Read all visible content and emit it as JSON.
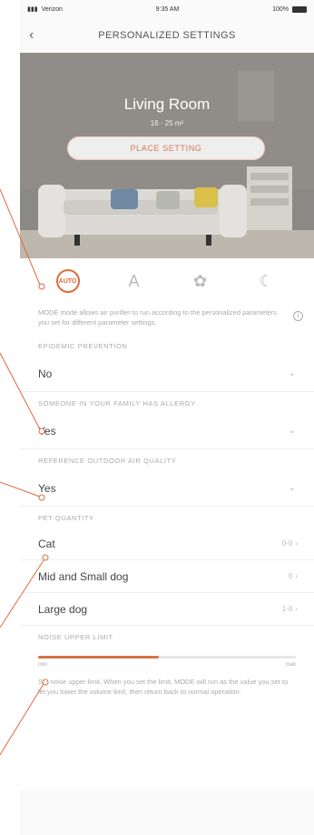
{
  "status_bar": {
    "carrier": "Verizon",
    "time": "9:35 AM",
    "battery": "100%"
  },
  "nav": {
    "title": "PERSONALIZED SETTINGS"
  },
  "hero": {
    "room_name": "Living Room",
    "room_sub": "16 · 25 m²",
    "place_button": "PLACE SETTING"
  },
  "modes": [
    {
      "name": "auto",
      "glyph": "AUTO"
    },
    {
      "name": "letter-a",
      "glyph": "A"
    },
    {
      "name": "fan",
      "glyph": "✿"
    },
    {
      "name": "moon",
      "glyph": "☾"
    }
  ],
  "description": "MODE mode allows air purifier to run according to the personalized parameters you set for different parameter settings.",
  "info_glyph": "i",
  "sections": {
    "epidemic": {
      "label": "EPIDEMIC PREVENTION",
      "value": "No"
    },
    "allergy": {
      "label": "SOMEONE IN YOUR FAMILY HAS ALLERGY",
      "value": "Yes"
    },
    "outdoor": {
      "label": "REFERENCE OUTDOOR AIR QUALITY",
      "value": "Yes"
    },
    "pets": {
      "label": "PET QUANTITY",
      "items": [
        {
          "name": "Cat",
          "count": "0-0"
        },
        {
          "name": "Mid and Small dog",
          "count": "0"
        },
        {
          "name": "Large dog",
          "count": "1-0"
        }
      ]
    },
    "noise": {
      "label": "NOISE UPPER LIMIT",
      "level": 0.47,
      "min_label": "min",
      "max_label": "max",
      "footnote": "Set noise upper limit. When you set the limit, MODE will run as the value you set to let you lower the volume limit, then return back to normal operation."
    }
  },
  "colors": {
    "accent": "#d47447"
  }
}
